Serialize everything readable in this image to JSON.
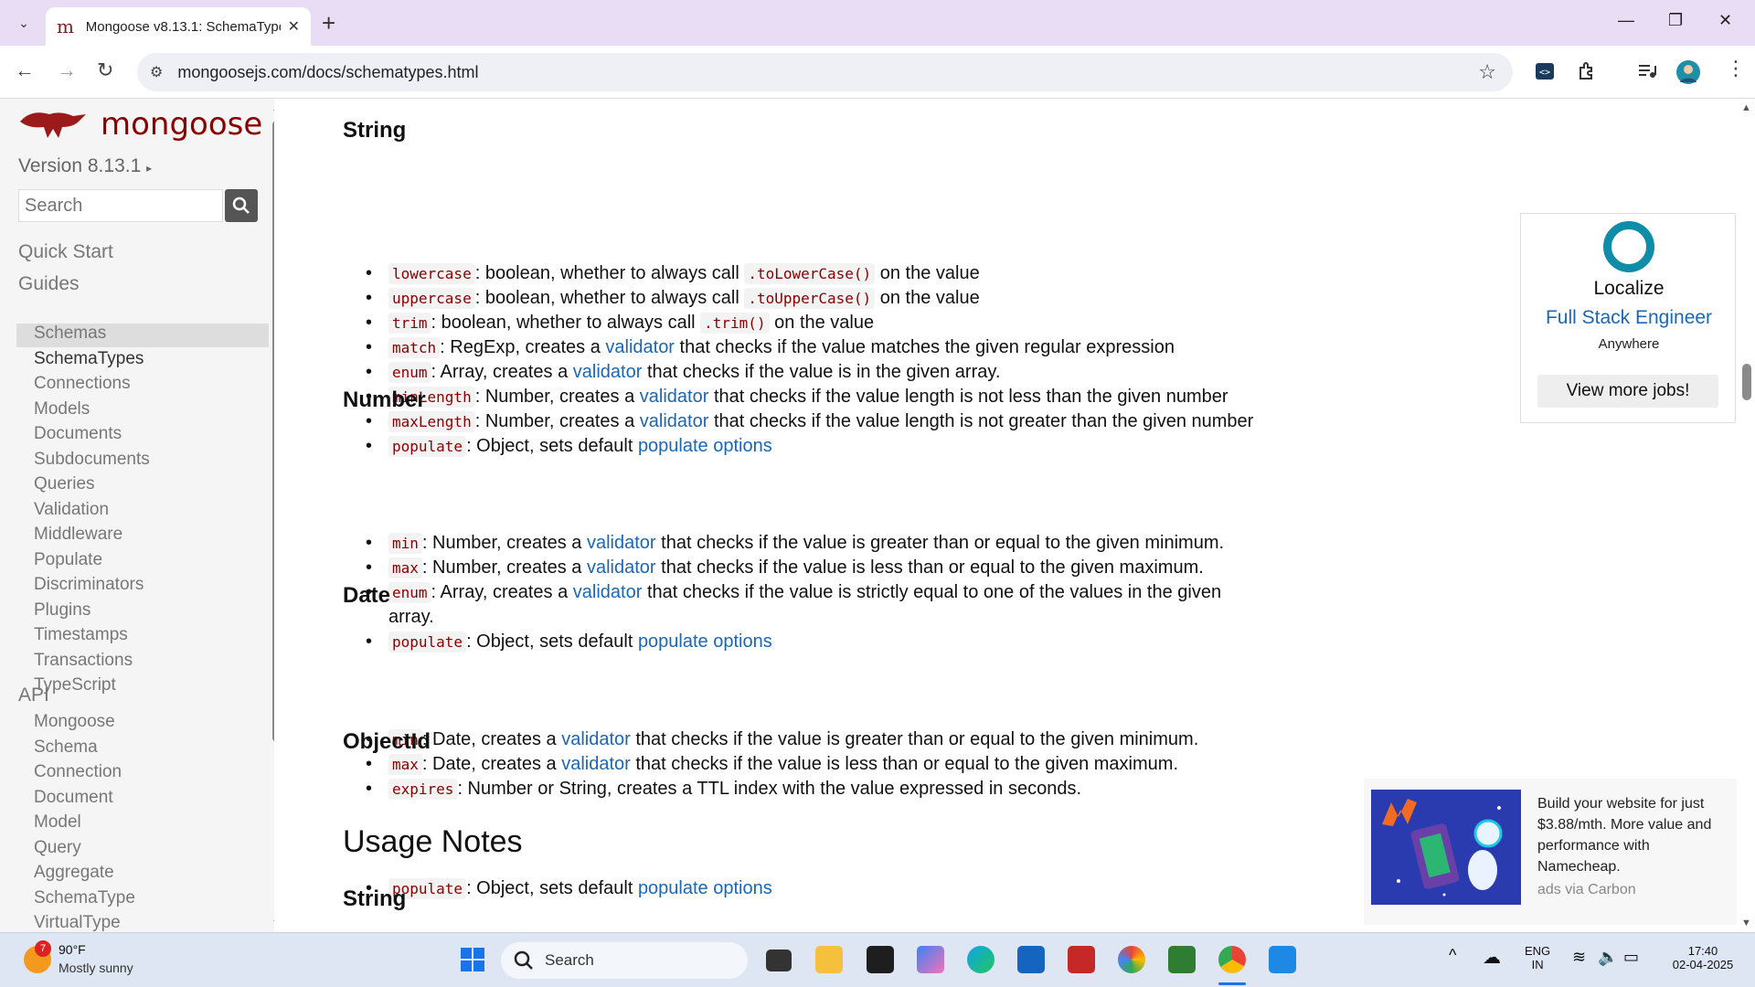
{
  "browser": {
    "tab_title": "Mongoose v8.13.1: SchemaTypes",
    "url": "mongoosejs.com/docs/schematypes.html"
  },
  "sidebar": {
    "brand": "mongoose",
    "version": "Version 8.13.1",
    "version_caret": "▸",
    "search_placeholder": "Search",
    "quick_start": "Quick Start",
    "guides_heading": "Guides",
    "guides": [
      "Schemas",
      "SchemaTypes",
      "Connections",
      "Models",
      "Documents",
      "Subdocuments",
      "Queries",
      "Validation",
      "Middleware",
      "Populate",
      "Discriminators",
      "Plugins",
      "Timestamps",
      "Transactions",
      "TypeScript"
    ],
    "api_heading": "API",
    "api": [
      "Mongoose",
      "Schema",
      "Connection",
      "Document",
      "Model",
      "Query",
      "Aggregate",
      "SchemaType",
      "VirtualType"
    ]
  },
  "content": {
    "string_heading": "String",
    "string_items": [
      {
        "code": "lowercase",
        "pre": ": boolean, whether to always call ",
        "code2": ".toLowerCase()",
        "post": " on the value"
      },
      {
        "code": "uppercase",
        "pre": ": boolean, whether to always call ",
        "code2": ".toUpperCase()",
        "post": " on the value"
      },
      {
        "code": "trim",
        "pre": ": boolean, whether to always call ",
        "code2": ".trim()",
        "post": " on the value"
      },
      {
        "code": "match",
        "pre": ": RegExp, creates a ",
        "link": "validator",
        "post": " that checks if the value matches the given regular expression"
      },
      {
        "code": "enum",
        "pre": ": Array, creates a ",
        "link": "validator",
        "post": " that checks if the value is in the given array."
      },
      {
        "code": "minLength",
        "pre": ": Number, creates a ",
        "link": "validator",
        "post": " that checks if the value length is not less than the given number"
      },
      {
        "code": "maxLength",
        "pre": ": Number, creates a ",
        "link": "validator",
        "post": " that checks if the value length is not greater than the given number"
      },
      {
        "code": "populate",
        "pre": ": Object, sets default ",
        "link": "populate options",
        "post": ""
      }
    ],
    "number_heading": "Number",
    "number_items": [
      {
        "code": "min",
        "pre": ": Number, creates a ",
        "link": "validator",
        "post": " that checks if the value is greater than or equal to the given minimum."
      },
      {
        "code": "max",
        "pre": ": Number, creates a ",
        "link": "validator",
        "post": " that checks if the value is less than or equal to the given maximum."
      },
      {
        "code": "enum",
        "pre": ": Array, creates a ",
        "link": "validator",
        "post": " that checks if the value is strictly equal to one of the values in the given",
        "wrap": "array."
      },
      {
        "code": "populate",
        "pre": ": Object, sets default ",
        "link": "populate options",
        "post": ""
      }
    ],
    "date_heading": "Date",
    "date_items": [
      {
        "code": "min",
        "pre": ": Date, creates a ",
        "link": "validator",
        "post": " that checks if the value is greater than or equal to the given minimum."
      },
      {
        "code": "max",
        "pre": ": Date, creates a ",
        "link": "validator",
        "post": " that checks if the value is less than or equal to the given maximum."
      },
      {
        "code": "expires",
        "pre": ": Number or String, creates a TTL index with the value expressed in seconds.",
        "post": ""
      }
    ],
    "objectid_heading": "ObjectId",
    "objectid_items": [
      {
        "code": "populate",
        "pre": ": Object, sets default ",
        "link": "populate options",
        "post": ""
      }
    ],
    "usage_heading": "Usage Notes",
    "usage_sub": "String"
  },
  "job_ad": {
    "company": "Localize",
    "title": "Full Stack Engineer",
    "location": "Anywhere",
    "button": "View more jobs!"
  },
  "carbon_ad": {
    "text": "Build your website for just $3.88/mth. More value and performance with Namecheap.",
    "via": "ads via Carbon"
  },
  "taskbar": {
    "weather_temp": "90°F",
    "weather_desc": "Mostly sunny",
    "weather_badge": "7",
    "search": "Search",
    "lang1": "ENG",
    "lang2": "IN",
    "time": "17:40",
    "date": "02-04-2025"
  },
  "colors": {
    "brand": "#880000",
    "link": "#1a67b5",
    "accent_teal": "#0e8ca8"
  }
}
